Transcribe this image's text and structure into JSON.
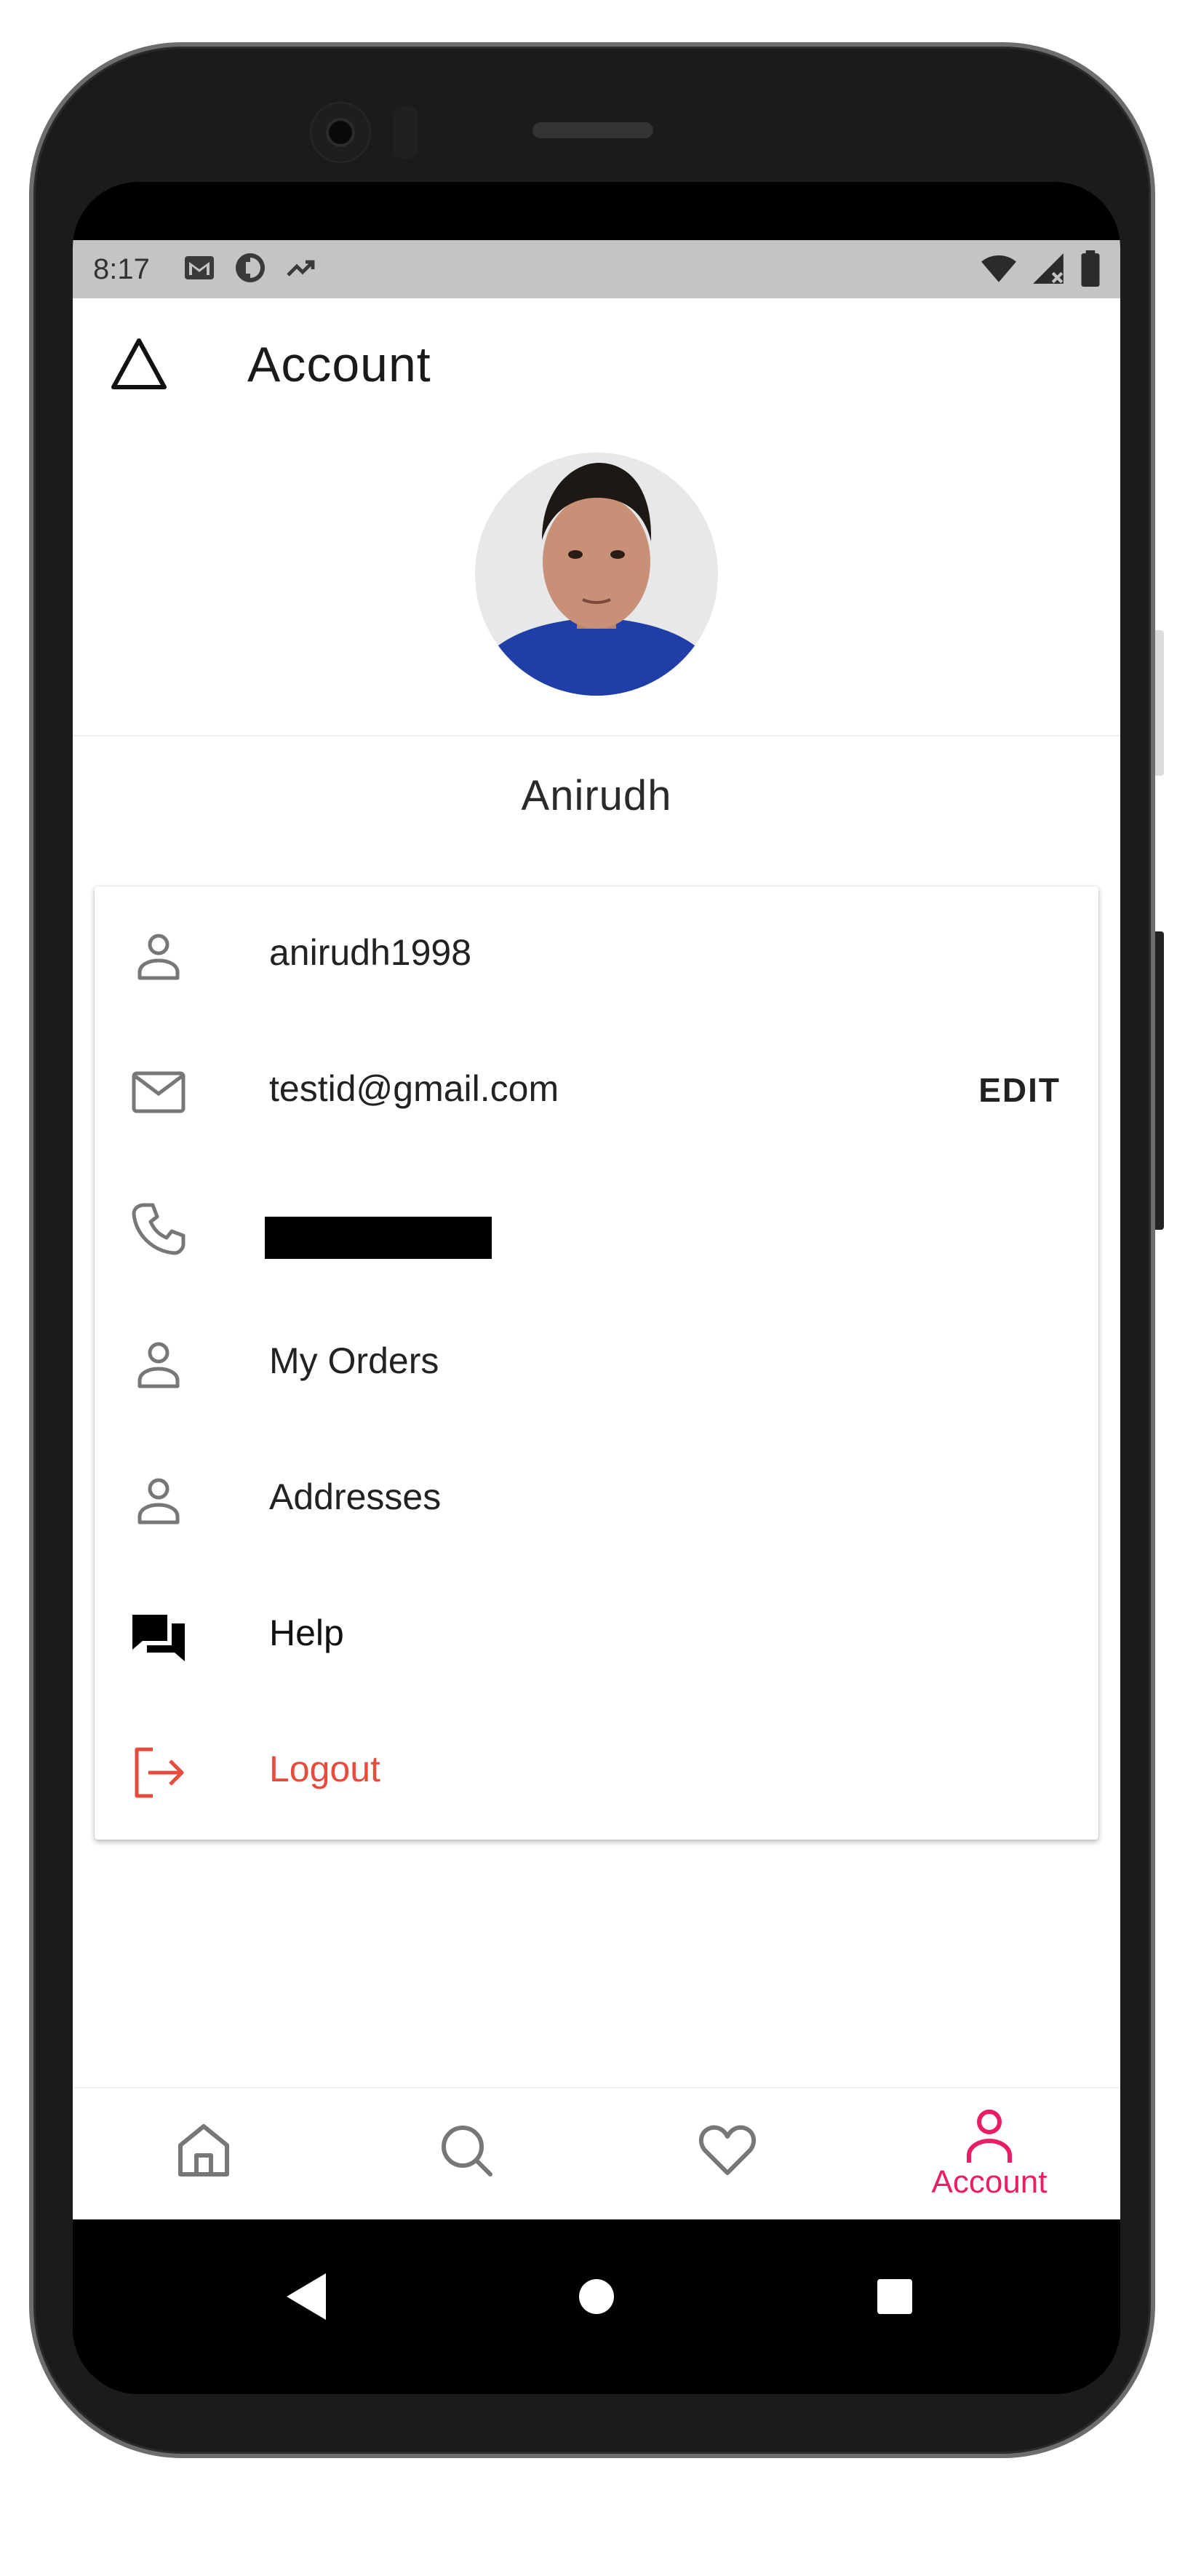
{
  "status_bar": {
    "time": "8:17",
    "left_icons": [
      "gmail-icon",
      "data-saver-icon",
      "trending-icon"
    ],
    "right_icons": [
      "wifi-icon",
      "cell-signal-icon",
      "battery-icon"
    ]
  },
  "header": {
    "title": "Account",
    "back_icon": "triangle-icon"
  },
  "profile": {
    "name": "Anirudh"
  },
  "menu": {
    "items": [
      {
        "icon": "person-icon",
        "label": "anirudh1998"
      },
      {
        "icon": "mail-icon",
        "label": "testid@gmail.com",
        "action": "EDIT"
      },
      {
        "icon": "phone-icon",
        "label": ""
      },
      {
        "icon": "person-icon",
        "label": "My Orders"
      },
      {
        "icon": "person-icon",
        "label": "Addresses"
      },
      {
        "icon": "chat-icon",
        "label": "Help"
      },
      {
        "icon": "logout-icon",
        "label": "Logout"
      }
    ]
  },
  "bottom_nav": {
    "items": [
      {
        "icon": "home-icon",
        "label": ""
      },
      {
        "icon": "search-icon",
        "label": ""
      },
      {
        "icon": "heart-icon",
        "label": ""
      },
      {
        "icon": "account-icon",
        "label": "Account",
        "active": true
      }
    ]
  },
  "colors": {
    "accent": "#e91e63",
    "logout": "#e74b3c",
    "icon_gray": "#777777",
    "status_bar": "#c4c4c4"
  }
}
